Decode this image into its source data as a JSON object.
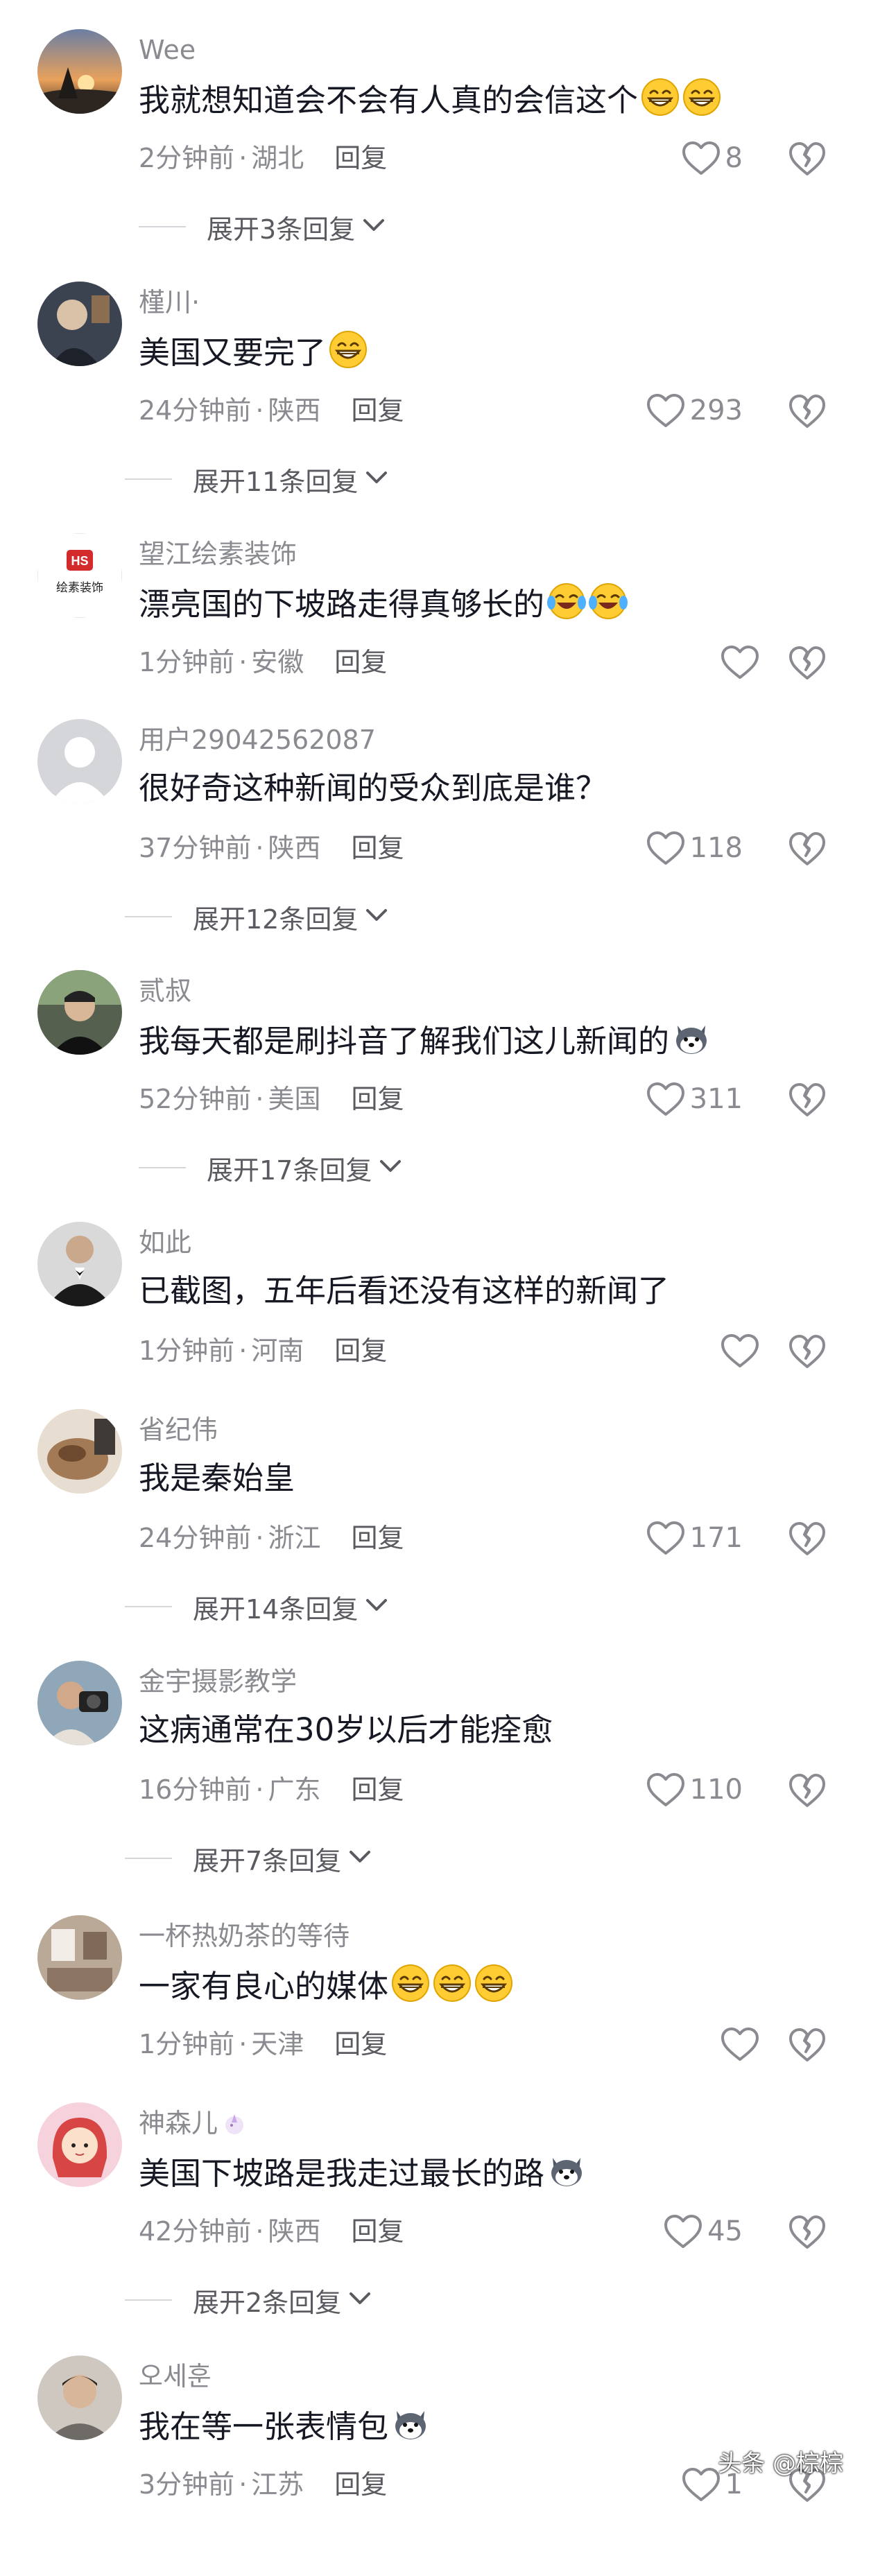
{
  "comments": [
    {
      "username": "Wee",
      "text": "我就想知道会不会有人真的会信这个",
      "emojis": [
        "grin-emoji",
        "grin-emoji"
      ],
      "time": "2分钟前",
      "location": "湖北",
      "reply_label": "回复",
      "likes": "8",
      "expand_label": "展开3条回复",
      "avatar": "sunset-avatar",
      "avatar_color": "#e9a15b"
    },
    {
      "username": "槿川·",
      "text": "美国又要完了",
      "emojis": [
        "grin-emoji"
      ],
      "time": "24分钟前",
      "location": "陕西",
      "reply_label": "回复",
      "likes": "293",
      "expand_label": "展开11条回复",
      "avatar": "dark-photo-avatar",
      "avatar_color": "#3c4350"
    },
    {
      "username": "望江绘素装饰",
      "text": "漂亮国的下坡路走得真够长的",
      "emojis": [
        "crying-laugh-emoji",
        "crying-laugh-emoji"
      ],
      "time": "1分钟前",
      "location": "安徽",
      "reply_label": "回复",
      "likes": "",
      "expand_label": "",
      "avatar": "logo-avatar",
      "avatar_color": "#d32b2b",
      "avatar_logo_text": "HS",
      "avatar_logo_caption": "绘素装饰"
    },
    {
      "username": "用户2904256208​7",
      "text": "很好奇这种新闻的受众到底是谁？",
      "emojis": [],
      "time": "37分钟前",
      "location": "陕西",
      "reply_label": "回复",
      "likes": "118",
      "expand_label": "展开12条回复",
      "avatar": "default-user-avatar",
      "avatar_color": "#d5d6da"
    },
    {
      "username": "贰叔",
      "text": "我每天都是刷抖音了解我们这儿新闻的",
      "emojis": [
        "husky-emoji"
      ],
      "time": "52分钟前",
      "location": "美国",
      "reply_label": "回复",
      "likes": "311",
      "expand_label": "展开17条回复",
      "avatar": "man-portrait-avatar",
      "avatar_color": "#55604f"
    },
    {
      "username": "如此",
      "text": "已截图，五年后看还没有这样的新闻了",
      "emojis": [],
      "time": "1分钟前",
      "location": "河南",
      "reply_label": "回复",
      "likes": "",
      "expand_label": "",
      "avatar": "suit-avatar",
      "avatar_color": "#1a1a1a"
    },
    {
      "username": "省纪伟",
      "text": "我是秦始皇",
      "emojis": [],
      "time": "24分钟前",
      "location": "浙江",
      "reply_label": "回复",
      "likes": "171",
      "expand_label": "展开14条回复",
      "avatar": "food-photo-avatar",
      "avatar_color": "#a27a55"
    },
    {
      "username": "金宇摄影教学",
      "text": "这病通常在30岁以后才能痊愈",
      "emojis": [],
      "time": "16分钟前",
      "location": "广东",
      "reply_label": "回复",
      "likes": "110",
      "expand_label": "展开7条回复",
      "avatar": "camera-person-avatar",
      "avatar_color": "#8fa7b8"
    },
    {
      "username": "一杯热奶茶的等待",
      "text": "一家有良心的媒体",
      "emojis": [
        "grin-emoji",
        "grin-emoji",
        "grin-emoji"
      ],
      "time": "1分钟前",
      "location": "天津",
      "reply_label": "回复",
      "likes": "",
      "expand_label": "",
      "avatar": "room-photo-avatar",
      "avatar_color": "#b9a996"
    },
    {
      "username": "神森儿",
      "username_badge": "unicorn-icon",
      "text": "美国下坡路是我走过最长的路",
      "emojis": [
        "husky-emoji"
      ],
      "time": "42分钟前",
      "location": "陕西",
      "reply_label": "回复",
      "likes": "45",
      "expand_label": "展开2条回复",
      "avatar": "red-hair-cartoon-avatar",
      "avatar_color": "#d84545"
    },
    {
      "username": "오세훈",
      "text": "我在等一张表情包",
      "emojis": [
        "husky-emoji"
      ],
      "time": "3分钟前",
      "location": "江苏",
      "reply_label": "回复",
      "likes": "1",
      "expand_label": "",
      "avatar": "young-man-avatar",
      "avatar_color": "#6e6a66"
    }
  ],
  "watermark": "头条 @棕棕",
  "colors": {
    "username": "#8a8b91",
    "text": "#161823",
    "meta": "#8a8b91",
    "icon": "#8a8b91"
  }
}
